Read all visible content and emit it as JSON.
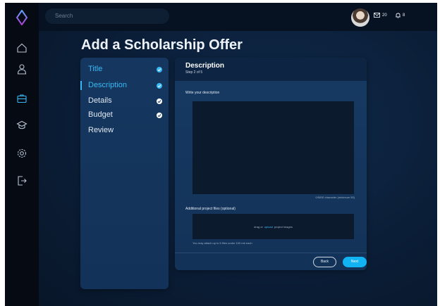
{
  "topbar": {
    "search_placeholder": "Search",
    "messages_count": "20",
    "notifications_count": "8"
  },
  "page_title": "Add a Scholarship Offer",
  "steps": [
    {
      "label": "Title",
      "state": "done"
    },
    {
      "label": "Description",
      "state": "active-done"
    },
    {
      "label": "Details",
      "state": "done"
    },
    {
      "label": "Budget",
      "state": "done"
    },
    {
      "label": "Review",
      "state": "todo"
    }
  ],
  "form": {
    "title": "Description",
    "subtitle": "Step 2 of 5",
    "description_label": "Write your description",
    "description_value": "",
    "counter": "0/5000 character (minimum 50)",
    "files_label": "Additional project files (optional)",
    "drop_prefix": "drag or",
    "drop_link": "upload",
    "drop_suffix": "project images",
    "files_hint": "You may attach up to 5 files under 100 mb each"
  },
  "buttons": {
    "back": "Back",
    "next": "Next"
  },
  "colors": {
    "accent": "#39b8f5",
    "next_button": "#12b3f3",
    "check_done": "#ffffff",
    "sidebar_bg": "#060a13"
  },
  "sidebar_icons": [
    "logo-icon",
    "home-icon",
    "profile-icon",
    "briefcase-icon",
    "graduation-icon",
    "settings-icon",
    "logout-icon"
  ]
}
